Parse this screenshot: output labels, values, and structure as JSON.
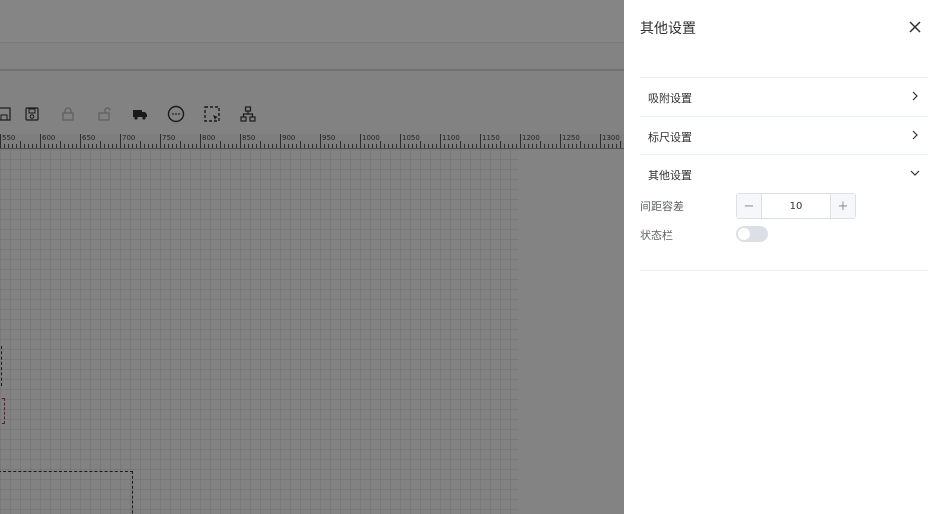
{
  "drawer": {
    "title": "其他设置",
    "sections": [
      {
        "label": "吸附设置",
        "expanded": false
      },
      {
        "label": "标尺设置",
        "expanded": false
      },
      {
        "label": "其他设置",
        "expanded": true
      }
    ],
    "spacing_tolerance": {
      "label": "间距容差",
      "value": "10",
      "minus": "−",
      "plus": "+"
    },
    "status_bar": {
      "label": "状态栏",
      "enabled": false
    }
  },
  "ruler": {
    "labels": [
      "550",
      "600",
      "650",
      "700",
      "750",
      "800",
      "850",
      "900",
      "950",
      "1000",
      "1050",
      "1100",
      "1150",
      "1200",
      "1250",
      "1300"
    ]
  },
  "toolbar": {
    "icons": [
      "save-icon",
      "save-as-icon",
      "lock-icon",
      "unlock-icon",
      "truck-icon",
      "more-circle-icon",
      "select-area-icon",
      "hierarchy-icon"
    ]
  },
  "colors": {
    "overlay": "rgba(0,0,0,0.48)",
    "switch_off": "#dcdfe6",
    "border": "#ebeef5"
  }
}
